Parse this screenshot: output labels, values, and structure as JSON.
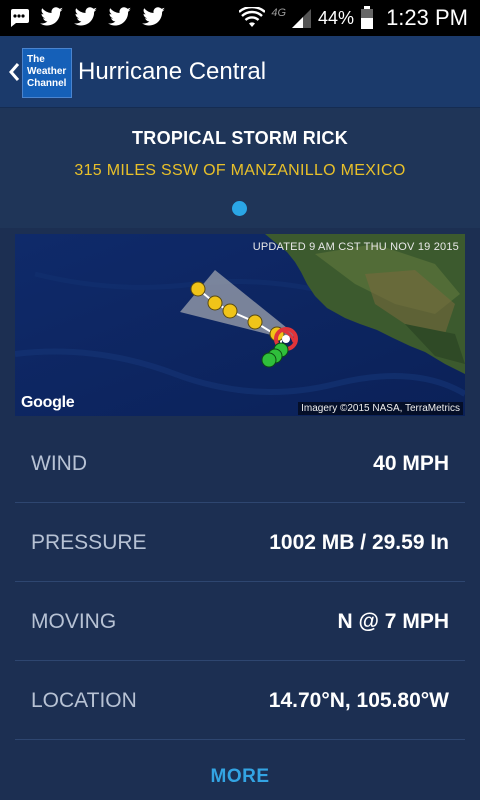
{
  "status_bar": {
    "network": "4G",
    "battery": "44%",
    "time": "1:23 PM"
  },
  "app_bar": {
    "logo_lines": [
      "The",
      "Weather",
      "Channel"
    ],
    "title": "Hurricane Central"
  },
  "storm": {
    "name": "TROPICAL STORM RICK",
    "location": "315 MILES SSW OF MANZANILLO MEXICO",
    "page_count": 1,
    "active_page": 1,
    "accent_color": "#e8c02a",
    "dot_color": "#2aa6e6"
  },
  "map": {
    "updated": "UPDATED 9 AM CST THU NOV 19 2015",
    "google": "Google",
    "attribution": "Imagery ©2015 NASA, TerraMetrics",
    "forecast_point_color": "#f0c419",
    "past_point_color": "#2fbf3b",
    "storm_marker_color": "#e0343a"
  },
  "details": [
    {
      "label": "WIND",
      "value": "40 MPH"
    },
    {
      "label": "PRESSURE",
      "value": "1002 MB / 29.59 In"
    },
    {
      "label": "MOVING",
      "value": "N @ 7 MPH"
    },
    {
      "label": "LOCATION",
      "value": "14.70°N, 105.80°W"
    }
  ],
  "more_label": "MORE",
  "more_color": "#33a4e3"
}
